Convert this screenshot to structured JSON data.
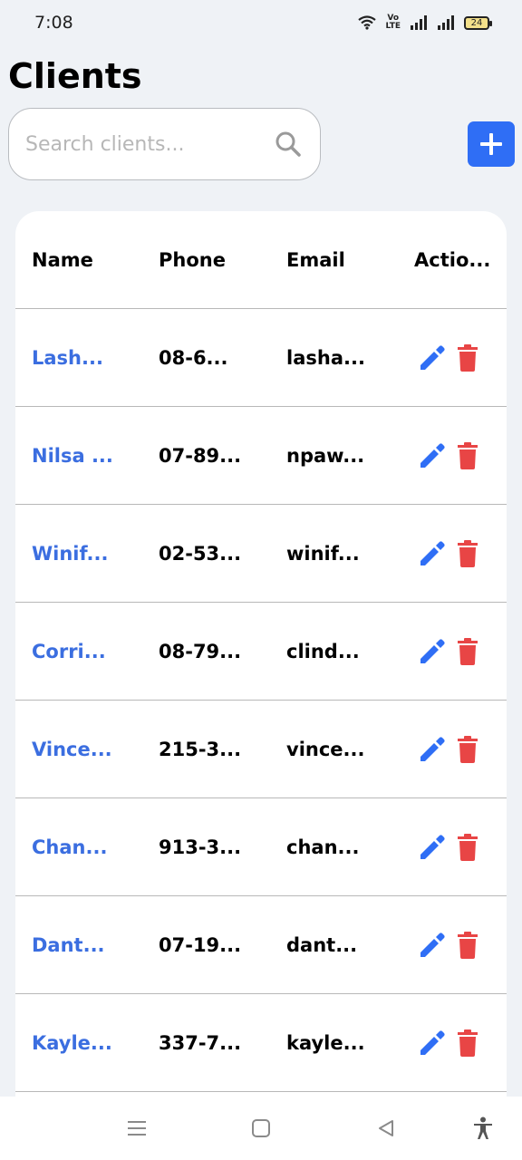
{
  "status_bar": {
    "time": "7:08",
    "volte_top": "Vo",
    "volte_bottom": "LTE",
    "battery": "24",
    "icons": [
      "wifi-icon",
      "volte-icon",
      "signal-icon",
      "signal-icon",
      "battery-icon"
    ]
  },
  "page": {
    "title": "Clients"
  },
  "search": {
    "placeholder": "Search clients...",
    "value": "",
    "icon": "search-icon"
  },
  "add_button": {
    "icon": "plus-icon",
    "color": "#2f6ef5"
  },
  "table": {
    "headers": {
      "name": "Name",
      "phone": "Phone",
      "email": "Email",
      "actions": "Actio..."
    },
    "rows": [
      {
        "name": "Lash...",
        "phone": "08-6...",
        "email": "lasha..."
      },
      {
        "name": "Nilsa ...",
        "phone": "07-89...",
        "email": "npaw..."
      },
      {
        "name": "Winif...",
        "phone": "02-53...",
        "email": "winif..."
      },
      {
        "name": "Corri...",
        "phone": "08-79...",
        "email": "clind..."
      },
      {
        "name": "Vince...",
        "phone": "215-3...",
        "email": "vince..."
      },
      {
        "name": "Chan...",
        "phone": "913-3...",
        "email": "chan..."
      },
      {
        "name": "Dant...",
        "phone": "07-19...",
        "email": "dant..."
      },
      {
        "name": "Kayle...",
        "phone": "337-7...",
        "email": "kayle..."
      }
    ],
    "action_icons": [
      "edit-icon",
      "delete-icon"
    ],
    "colors": {
      "link": "#3b6ee0",
      "edit": "#2f6ef5",
      "delete": "#e84545"
    }
  },
  "nav_bar": {
    "icons": [
      "menu-icon",
      "home-icon",
      "back-icon",
      "accessibility-icon"
    ]
  }
}
